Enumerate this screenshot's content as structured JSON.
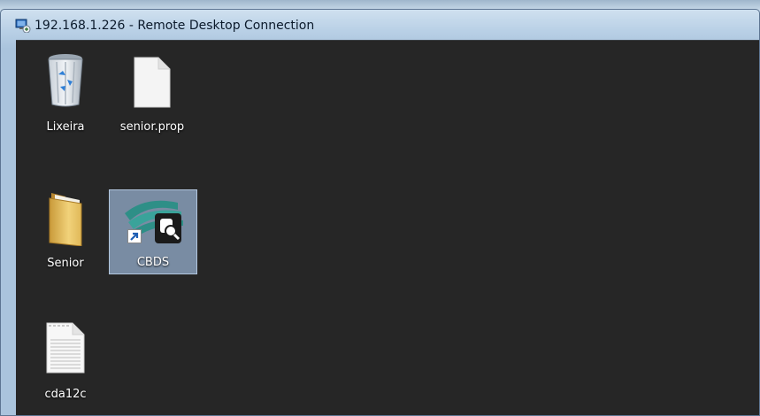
{
  "window": {
    "title": "192.168.1.226 - Remote Desktop Connection"
  },
  "desktop": {
    "icons": [
      {
        "label": "Lixeira",
        "icon": "recycle-bin-icon"
      },
      {
        "label": "senior.prop",
        "icon": "file-icon"
      },
      {
        "label": "Senior",
        "icon": "folder-icon"
      },
      {
        "label": "CBDS",
        "icon": "cbds-app-icon",
        "selected": true,
        "shortcut": true
      },
      {
        "label": "cda12c",
        "icon": "text-document-icon"
      }
    ]
  },
  "colors": {
    "desktop_background": "#262626",
    "selection": "#96afcd",
    "title_bar": "#b9d0e6"
  }
}
